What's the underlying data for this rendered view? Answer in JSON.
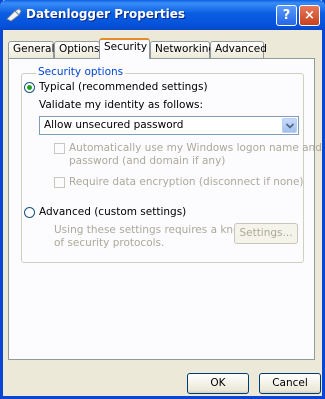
{
  "window": {
    "title": "Datenlogger Properties"
  },
  "title_buttons": {
    "help": "?",
    "close": "×"
  },
  "tabs": [
    {
      "label": "General",
      "active": false
    },
    {
      "label": "Options",
      "active": false
    },
    {
      "label": "Security",
      "active": true
    },
    {
      "label": "Networking",
      "active": false
    },
    {
      "label": "Advanced",
      "active": false
    }
  ],
  "security": {
    "group_label": "Security options",
    "typical_label": "Typical (recommended settings)",
    "typical_selected": true,
    "validate_label": "Validate my identity as follows:",
    "validate_value": "Allow unsecured password",
    "auto_logon_label_1": "Automatically use my Windows logon name and",
    "auto_logon_label_2": "password (and domain if any)",
    "auto_logon_checked": false,
    "encryption_label": "Require data encryption (disconnect if none)",
    "encryption_checked": false,
    "advanced_label": "Advanced (custom settings)",
    "advanced_selected": false,
    "advanced_desc_1": "Using these settings requires a knowledge",
    "advanced_desc_2": "of security protocols.",
    "settings_button": "Settings..."
  },
  "footer": {
    "ok": "OK",
    "cancel": "Cancel"
  }
}
